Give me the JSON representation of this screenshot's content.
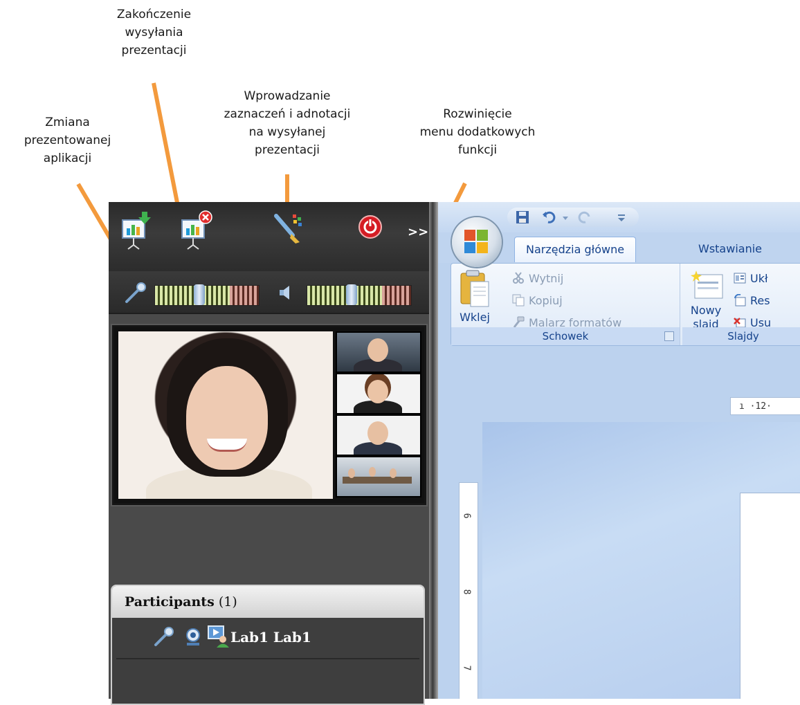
{
  "callouts": {
    "change_app": [
      "Zmiana",
      "prezentowanej",
      "aplikacji"
    ],
    "stop_sending": [
      "Zakończenie",
      "wysyłania",
      "prezentacji"
    ],
    "annotations": [
      "Wprowadzanie",
      "zaznaczeń i adnotacji",
      "na wysyłanej",
      "prezentacji"
    ],
    "more_menu": [
      "Rozwinięcie",
      "menu dodatkowych",
      "funkcji"
    ]
  },
  "colors": {
    "arrow": "#f39a3d",
    "panel": "#4a4a4a",
    "ribbon_text": "#15428b"
  },
  "toolbar": {
    "icons": [
      "change-app-icon",
      "stop-presentation-icon",
      "annotation-brush-icon",
      "power-icon"
    ],
    "more_label": ">>"
  },
  "audio": {
    "mic_icon": "microphone-icon",
    "speaker_icon": "speaker-icon"
  },
  "participants": {
    "title": "Participants",
    "count": "(1)",
    "rows": [
      {
        "name": "Lab1 Lab1"
      }
    ]
  },
  "ppt": {
    "tabs": [
      "Narzędzia główne",
      "Wstawianie"
    ],
    "clipboard": {
      "paste": "Wklej",
      "cut": "Wytnij",
      "copy": "Kopiuj",
      "format_painter": "Malarz formatów",
      "group": "Schowek"
    },
    "slides": {
      "new_slide_1": "Nowy",
      "new_slide_2": "slajd",
      "layout": "Ukł",
      "reset": "Res",
      "delete": "Usu",
      "group": "Slajdy"
    },
    "ruler_h": "ı ·12·",
    "ruler_v": [
      "6",
      "8",
      "7"
    ]
  }
}
